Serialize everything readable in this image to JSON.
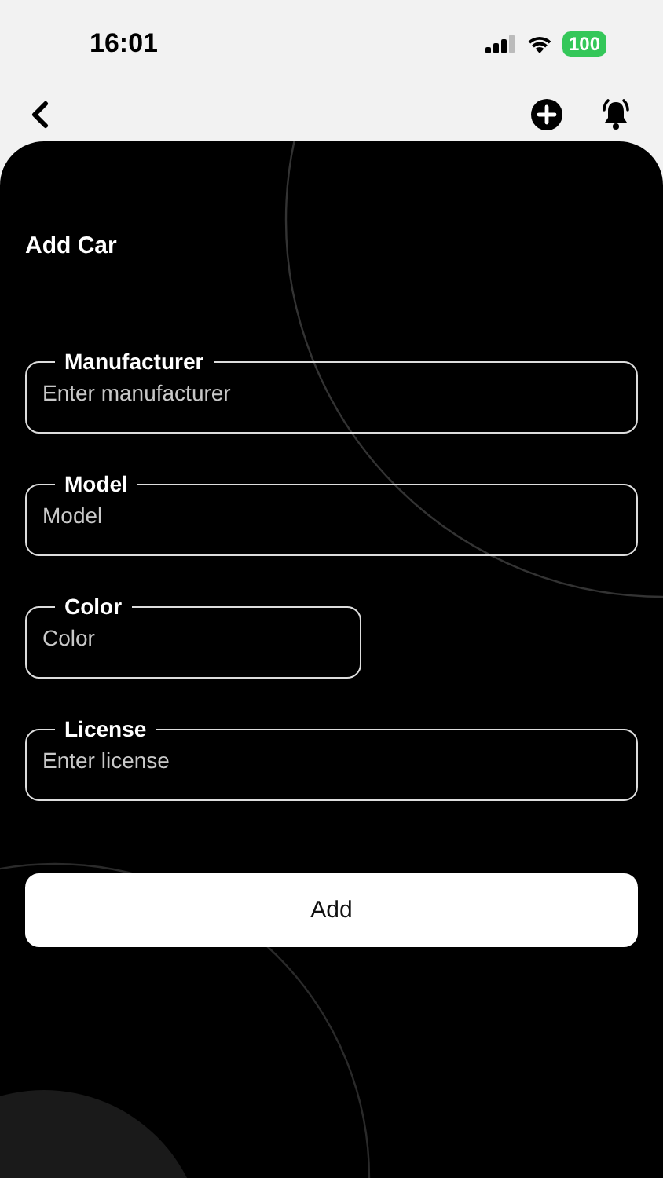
{
  "status_bar": {
    "time": "16:01",
    "battery": "100"
  },
  "title": "Add Car",
  "fields": [
    {
      "label": "Manufacturer",
      "placeholder": "Enter manufacturer",
      "kind": "full"
    },
    {
      "label": "Model",
      "placeholder": "Model",
      "kind": "full"
    },
    {
      "label": "Color",
      "placeholder": "Color",
      "kind": "half"
    },
    {
      "label": "License",
      "placeholder": "Enter license",
      "kind": "full"
    }
  ],
  "button": "Add"
}
